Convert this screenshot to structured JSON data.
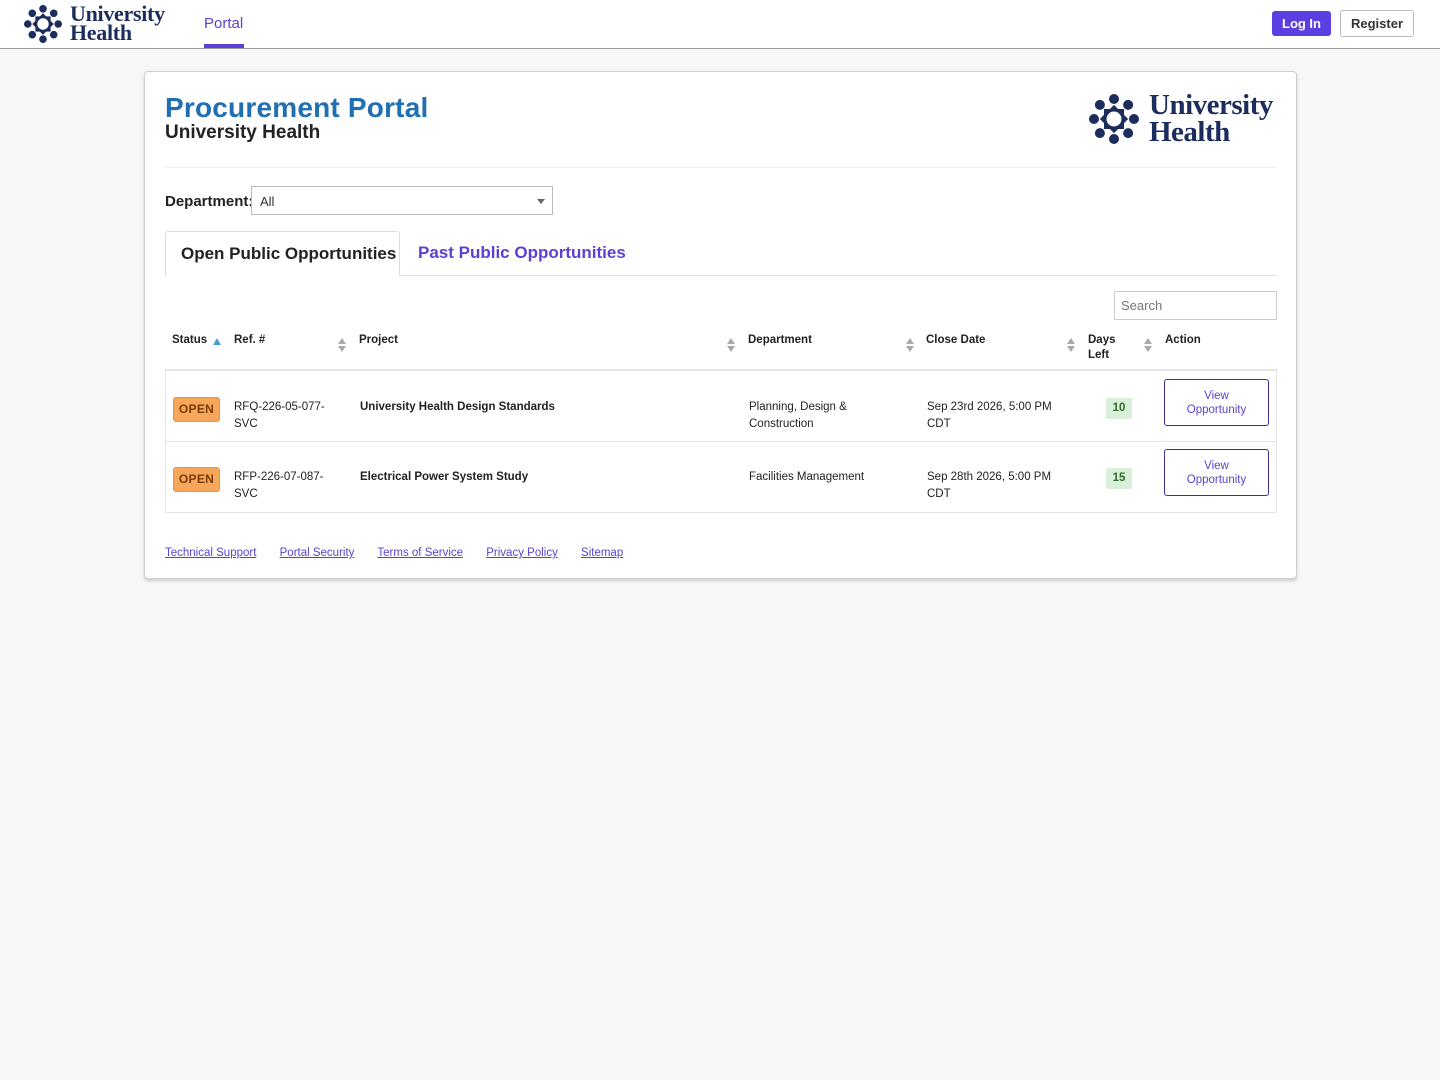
{
  "brand": {
    "line1": "University",
    "line2": "Health"
  },
  "nav": {
    "tab_portal": "Portal",
    "login_label": "Log In",
    "register_label": "Register"
  },
  "header": {
    "title": "Procurement Portal",
    "subtitle": "University Health"
  },
  "filter": {
    "department_label": "Department:",
    "department_value": "All"
  },
  "tabs": [
    {
      "label": "Open Public Opportunities",
      "active": true
    },
    {
      "label": "Past Public Opportunities",
      "active": false
    }
  ],
  "search": {
    "placeholder": "Search"
  },
  "table": {
    "columns": [
      "Status",
      "Ref. #",
      "Project",
      "Department",
      "Close Date",
      "Days Left",
      "Action"
    ],
    "rows": [
      {
        "status": "OPEN",
        "ref": "RFQ-226-05-077-SVC",
        "project": "University Health Design Standards",
        "department": "Planning, Design & Construction",
        "close_date": "Sep 23rd 2026, 5:00 PM CDT",
        "days_left": "10",
        "action": "View Opportunity"
      },
      {
        "status": "OPEN",
        "ref": "RFP-226-07-087-SVC",
        "project": "Electrical Power System Study",
        "department": "Facilities Management",
        "close_date": "Sep 28th 2026, 5:00 PM CDT",
        "days_left": "15",
        "action": "View Opportunity"
      }
    ]
  },
  "footer": {
    "links": [
      "Technical Support",
      "Portal Security",
      "Terms of Service",
      "Privacy Policy",
      "Sitemap"
    ]
  },
  "colors": {
    "accent": "#5d3fd3",
    "title_blue": "#1f6fb2",
    "brand_navy": "#1c2c5c",
    "open_badge": "#f6a75c",
    "days_badge": "#d9efd9"
  }
}
